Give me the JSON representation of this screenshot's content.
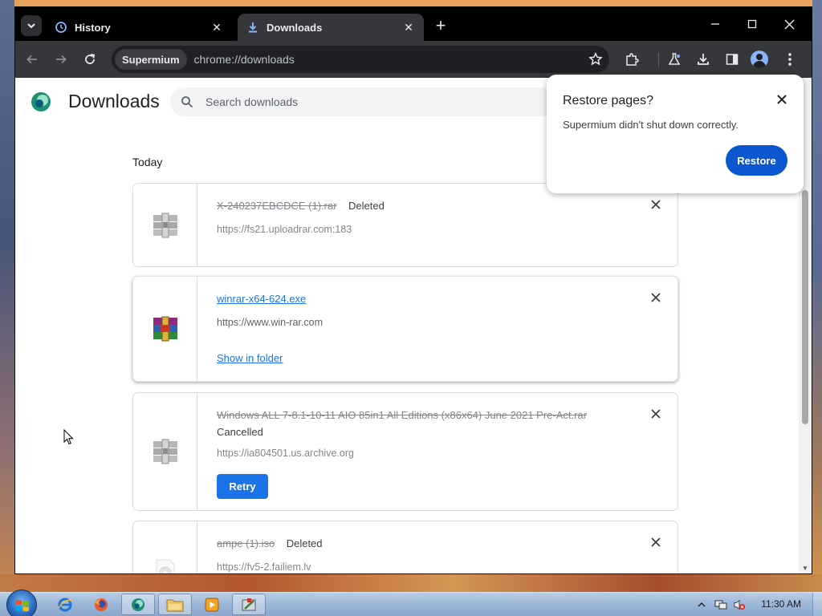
{
  "browser": {
    "tabs": [
      {
        "label": "History",
        "icon": "history-icon",
        "active": false
      },
      {
        "label": "Downloads",
        "icon": "download-icon",
        "active": true
      }
    ],
    "new_tab_symbol": "+",
    "omnibox": {
      "chip": "Supermium",
      "url": "chrome://downloads"
    }
  },
  "page": {
    "title": "Downloads",
    "search_placeholder": "Search downloads",
    "section_label": "Today"
  },
  "downloads": [
    {
      "file": "X-240237EBCDCE (1).rar",
      "status": "Deleted",
      "url": "https://fs21.uploadrar.com:183",
      "icon": "rar-archive-icon-greyed"
    },
    {
      "file": "winrar-x64-624.exe",
      "status": "",
      "url": "https://www.win-rar.com",
      "action": "Show in folder",
      "icon": "winrar-icon"
    },
    {
      "file": "Windows ALL 7-8.1-10-11 AIO 85in1 All Editions (x86x64) June 2021 Pre-Act.rar",
      "status": "Cancelled",
      "url": "https://ia804501.us.archive.org",
      "action": "Retry",
      "icon": "rar-archive-icon-greyed"
    },
    {
      "file": "ampe (1).iso",
      "status": "Deleted",
      "url": "https://fv5-2.failiem.lv",
      "icon": "iso-disc-icon-greyed"
    }
  ],
  "restore_bubble": {
    "title": "Restore pages?",
    "message": "Supermium didn't shut down correctly.",
    "button": "Restore"
  },
  "taskbar": {
    "clock": "11:30 AM"
  },
  "colors": {
    "accent": "#1a73e8",
    "restore_button": "#0b57d0",
    "chrome_dark": "#36373b",
    "tab_strip": "#000000"
  }
}
